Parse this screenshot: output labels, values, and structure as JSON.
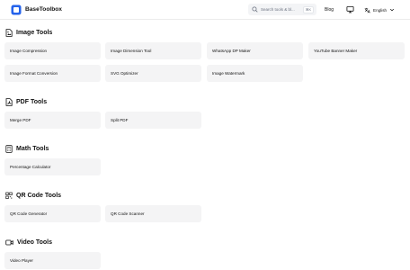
{
  "header": {
    "brand": "BaseToolbox",
    "search_placeholder": "Search tools & bl...",
    "search_shortcut": "⌘K",
    "blog": "Blog",
    "language": "English"
  },
  "sections": {
    "image": {
      "title": "Image Tools",
      "items": [
        "Image Compression",
        "Image Dimension Tool",
        "WhatsApp DP Maker",
        "YouTube Banner Maker",
        "Image Format Conversion",
        "SVG Optimizer",
        "Image Watermark"
      ]
    },
    "pdf": {
      "title": "PDF Tools",
      "items": [
        "Merge PDF",
        "Split PDF"
      ]
    },
    "math": {
      "title": "Math Tools",
      "items": [
        "Percentage Calculator"
      ]
    },
    "qr": {
      "title": "QR Code Tools",
      "items": [
        "QR Code Generator",
        "QR Code Scanner"
      ]
    },
    "video": {
      "title": "Video Tools",
      "items": [
        "Video Player"
      ]
    }
  }
}
